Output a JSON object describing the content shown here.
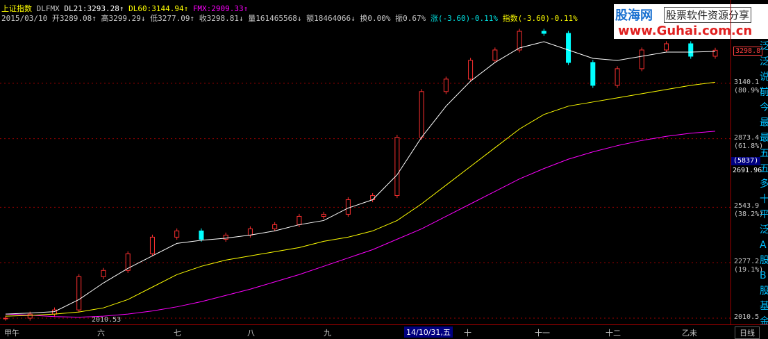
{
  "header": {
    "title": "上证指数",
    "indicator": "DLFMX",
    "dl21": "DL21:3293.28↑",
    "dl60": "DL60:3144.94↑",
    "fmx": "FMX:2909.33↑",
    "date": "2015/03/10",
    "open": "开3289.08↑",
    "high": "高3299.29↓",
    "low": "低3277.09↑",
    "close": "收3298.81↓",
    "volume": "量161465568↓",
    "amount": "额18464066↓",
    "turnover": "换0.00%",
    "amplitude": "振0.67%",
    "change": "涨(-3.60)-0.11%",
    "index_change": "指数(-3.60)-0.11%"
  },
  "y_axis": {
    "labels": [
      {
        "value": 3140.1,
        "text": "3140.1",
        "pct": "(80.9%)"
      },
      {
        "value": 2873.4,
        "text": "2873.4",
        "pct": "(61.8%)"
      },
      {
        "value": 2543.9,
        "text": "2543.9",
        "pct": "(38.2%)"
      },
      {
        "value": 2277.2,
        "text": "2277.2",
        "pct": "(19.1%)"
      },
      {
        "value": 2010.5,
        "text": "2010.5",
        "pct": ""
      }
    ],
    "current_price": "3298.8",
    "cursor_count": "(5837)",
    "cursor_value": "2691.96"
  },
  "x_axis": {
    "labels": [
      "甲午",
      "六",
      "七",
      "八",
      "九",
      "十",
      "十一",
      "十二",
      "乙未"
    ],
    "cursor_date": "14/10/31,五",
    "period": "日线"
  },
  "min_label": "2010.53",
  "logo": {
    "name": "股海网",
    "slogan": "股票软件资源分享",
    "url": "www.Guhai.com.cn"
  },
  "side_text": "泛泛说前今最最五五多十平泛A股B股基金债权其他A股B",
  "colors": {
    "up": "#ff3030",
    "down": "#00ffff",
    "dl21": "#ffffff",
    "dl60": "#ffff00",
    "fmx": "#ff00ff",
    "grid": "#a00000"
  },
  "chart_data": {
    "type": "candlestick",
    "ylim": [
      2010.5,
      3406.8
    ],
    "x": [
      "2014-05",
      "2014-06",
      "2014-07",
      "2014-08",
      "2014-09",
      "2014-10",
      "2014-11",
      "2014-12",
      "2015-01",
      "2015-03-10"
    ],
    "close": [
      2010.5,
      2030,
      2050,
      2210,
      2240,
      2320,
      2400,
      2430,
      2390,
      2410,
      2440,
      2460,
      2500,
      2510,
      2580,
      2600,
      2880,
      3100,
      3160,
      3250,
      3300,
      3390,
      3380,
      3240,
      3130,
      3210,
      3300,
      3330,
      3270,
      3298.8
    ],
    "dl21": [
      2030,
      2035,
      2042,
      2100,
      2180,
      2250,
      2310,
      2370,
      2385,
      2395,
      2410,
      2430,
      2460,
      2480,
      2540,
      2580,
      2700,
      2880,
      3030,
      3150,
      3240,
      3310,
      3340,
      3300,
      3260,
      3250,
      3270,
      3290,
      3290,
      3293.28
    ],
    "dl60": [
      2020,
      2024,
      2030,
      2040,
      2060,
      2100,
      2160,
      2220,
      2260,
      2290,
      2310,
      2330,
      2350,
      2380,
      2400,
      2430,
      2480,
      2560,
      2650,
      2740,
      2830,
      2920,
      2990,
      3030,
      3050,
      3070,
      3090,
      3110,
      3130,
      3144.94
    ],
    "fmx": [
      2030,
      2025,
      2018,
      2015,
      2020,
      2030,
      2045,
      2065,
      2090,
      2120,
      2150,
      2185,
      2220,
      2260,
      2300,
      2340,
      2390,
      2440,
      2500,
      2560,
      2620,
      2680,
      2730,
      2775,
      2810,
      2840,
      2865,
      2885,
      2900,
      2909.33
    ]
  }
}
